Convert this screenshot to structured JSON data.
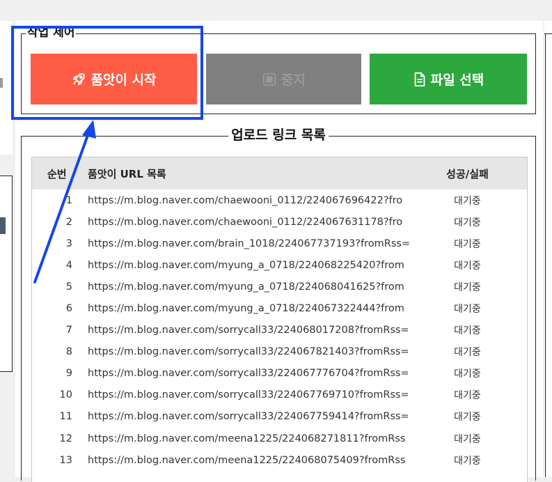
{
  "controls": {
    "legend": "작업 제어",
    "start_label": "품앗이 시작",
    "stop_label": "중지",
    "file_label": "파일 선택"
  },
  "list": {
    "legend": "업로드 링크 목록",
    "headers": {
      "num": "순번",
      "url": "품앗이 URL 목록",
      "status": "성공/실패"
    },
    "rows": [
      {
        "num": "1",
        "url": "https://m.blog.naver.com/chaewooni_0112/224067696422?fro",
        "status": "대기중"
      },
      {
        "num": "2",
        "url": "https://m.blog.naver.com/chaewooni_0112/224067631178?fro",
        "status": "대기중"
      },
      {
        "num": "3",
        "url": "https://m.blog.naver.com/brain_1018/224067737193?fromRss=",
        "status": "대기중"
      },
      {
        "num": "4",
        "url": "https://m.blog.naver.com/myung_a_0718/224068225420?from",
        "status": "대기중"
      },
      {
        "num": "5",
        "url": "https://m.blog.naver.com/myung_a_0718/224068041625?from",
        "status": "대기중"
      },
      {
        "num": "6",
        "url": "https://m.blog.naver.com/myung_a_0718/224067322444?from",
        "status": "대기중"
      },
      {
        "num": "7",
        "url": "https://m.blog.naver.com/sorrycall33/224068017208?fromRss=",
        "status": "대기중"
      },
      {
        "num": "8",
        "url": "https://m.blog.naver.com/sorrycall33/224067821403?fromRss=",
        "status": "대기중"
      },
      {
        "num": "9",
        "url": "https://m.blog.naver.com/sorrycall33/224067776704?fromRss=",
        "status": "대기중"
      },
      {
        "num": "10",
        "url": "https://m.blog.naver.com/sorrycall33/224067769710?fromRss=",
        "status": "대기중"
      },
      {
        "num": "11",
        "url": "https://m.blog.naver.com/sorrycall33/224067759414?fromRss=",
        "status": "대기중"
      },
      {
        "num": "12",
        "url": "https://m.blog.naver.com/meena1225/224068271811?fromRss",
        "status": "대기중"
      },
      {
        "num": "13",
        "url": "https://m.blog.naver.com/meena1225/224068075409?fromRss",
        "status": "대기중"
      }
    ]
  },
  "icons": {
    "start": "rocket-icon",
    "stop": "stop-icon",
    "file": "document-icon"
  },
  "colors": {
    "start": "#ff5c45",
    "stop": "#808080",
    "file": "#2ca83e",
    "annotation": "#1746e6"
  }
}
